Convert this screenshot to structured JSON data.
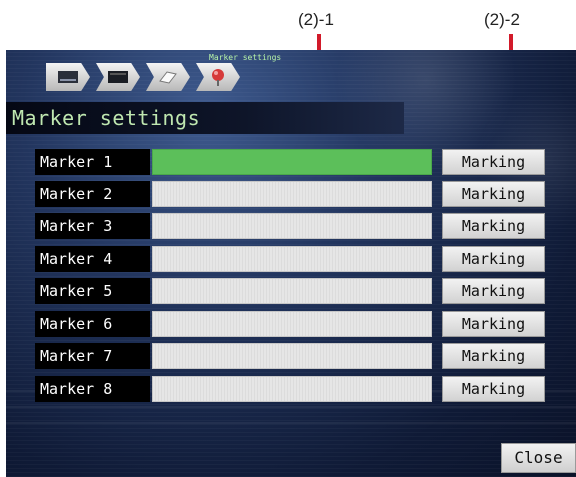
{
  "callouts": {
    "left": "(2)-1",
    "right": "(2)-2"
  },
  "breadcrumb": {
    "label": "Marker settings",
    "icons": [
      "recorder-icon",
      "device-icon",
      "paper-icon",
      "pin-icon"
    ]
  },
  "title": "Marker settings",
  "markers": [
    {
      "label": "Marker 1",
      "button": "Marking"
    },
    {
      "label": "Marker 2",
      "button": "Marking"
    },
    {
      "label": "Marker 3",
      "button": "Marking"
    },
    {
      "label": "Marker 4",
      "button": "Marking"
    },
    {
      "label": "Marker 5",
      "button": "Marking"
    },
    {
      "label": "Marker 6",
      "button": "Marking"
    },
    {
      "label": "Marker 7",
      "button": "Marking"
    },
    {
      "label": "Marker 8",
      "button": "Marking"
    }
  ],
  "close_label": "Close",
  "colors": {
    "active_field": "#5cbf5a",
    "callout_line": "#d21a2a",
    "title_text": "#bfe7b0"
  }
}
